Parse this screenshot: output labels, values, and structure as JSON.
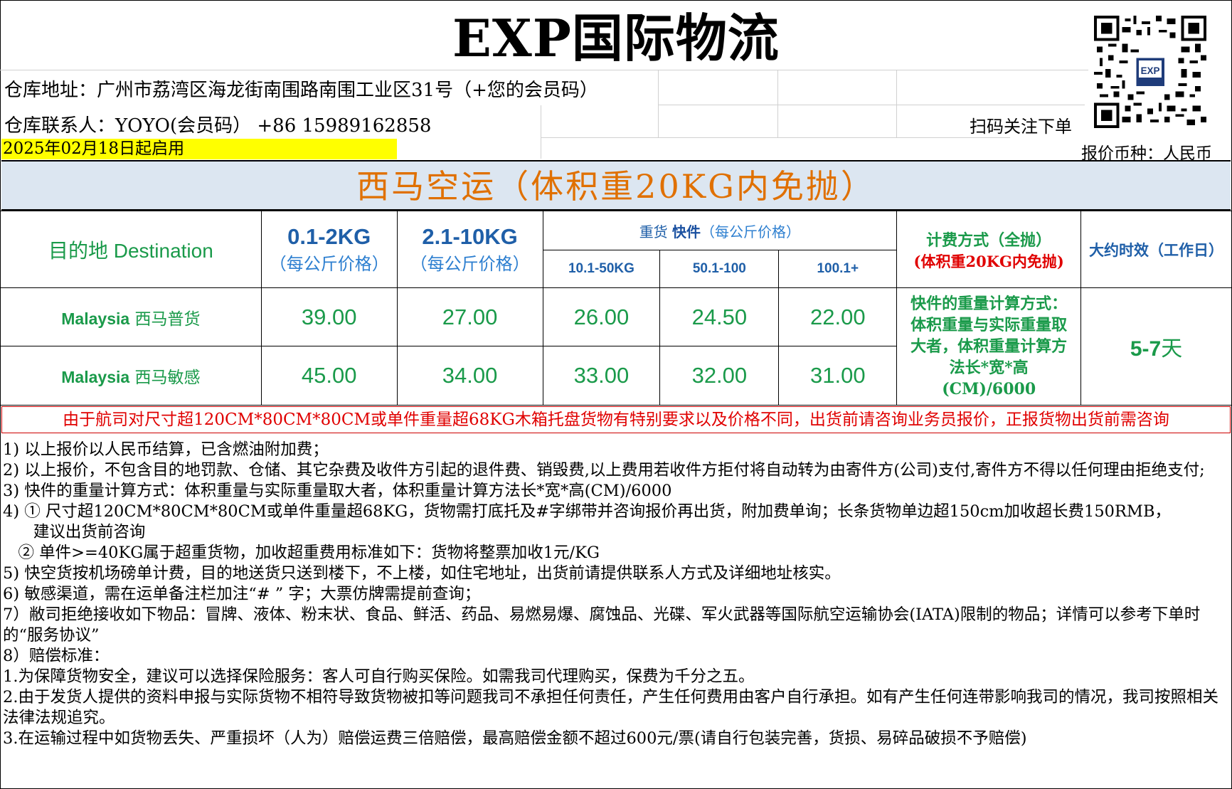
{
  "header": {
    "title": "EXP国际物流",
    "warehouse_address": "仓库地址：广州市荔湾区海龙街南围路南围工业区31号（+您的会员码）",
    "warehouse_contact": "仓库联系人：YOYO(会员码）  +86  15989162858",
    "effective_date": "2025年02月18日起启用",
    "scan_label": "扫码关注下单",
    "currency": "报价币种：人民币",
    "qr_logo": "EXP"
  },
  "banner": "西马空运（体积重20KG内免抛）",
  "table": {
    "col_destination": "目的地 Destination",
    "col1_main": "0.1-2KG",
    "col1_sub": "（每公斤价格）",
    "col2_main": "2.1-10KG",
    "col2_sub": "（每公斤价格）",
    "heavy_a": "重货",
    "heavy_b": "快件",
    "heavy_c": "（每公斤价格）",
    "tier1": "10.1-50KG",
    "tier2": "50.1-100",
    "tier3": "100.1+",
    "billing_title": "计费方式（全抛）",
    "billing_sub": "(体积重20KG内免抛)",
    "transit_title": "大约时效（工作日）",
    "rows": [
      {
        "dest_en": "Malaysia",
        "dest_cn": "西马普货",
        "p1": "39.00",
        "p2": "27.00",
        "p3": "26.00",
        "p4": "24.50",
        "p5": "22.00"
      },
      {
        "dest_en": "Malaysia",
        "dest_cn": "西马敏感",
        "p1": "45.00",
        "p2": "34.00",
        "p3": "33.00",
        "p4": "32.00",
        "p5": "31.00"
      }
    ],
    "billing_desc": "快件的重量计算方式：体积重量与实际重量取大者，体积重量计算方法长*宽*高(CM)/6000",
    "transit_num": "5-7",
    "transit_unit": "天"
  },
  "notice": "由于航司对尺寸超120CM*80CM*80CM或单件重量超68KG木箱托盘货物有特别要求以及价格不同，出货前请咨询业务员报价，正报货物出货前需咨询",
  "terms": [
    "1) 以上报价以人民币结算，已含燃油附加费；",
    "2) 以上报价，不包含目的地罚款、仓储、其它杂费及收件方引起的退件费、销毁费,以上费用若收件方拒付将自动转为由寄件方(公司)支付,寄件方不得以任何理由拒绝支付;",
    "3) 快件的重量计算方式：体积重量与实际重量取大者，体积重量计算方法长*宽*高(CM)/6000",
    "4) ① 尺寸超120CM*80CM*80CM或单件重量超68KG，货物需打底托及#字绑带并咨询报价再出货，附加费单询；长条货物单边超150cm加收超长费150RMB，",
    "      建议出货前咨询",
    "   ② 单件>=40KG属于超重货物，加收超重费用标准如下：货物将整票加收1元/KG",
    "5) 快空货按机场磅单计费，目的地送货只送到楼下，不上楼，如住宅地址，出货前请提供联系人方式及详细地址核实。",
    "6) 敏感渠道，需在运单备注栏加注“# ” 字；大票仿牌需提前查询；",
    "7）敝司拒绝接收如下物品：冒牌、液体、粉末状、食品、鲜活、药品、易燃易爆、腐蚀品、光碟、军火武器等国际航空运输协会(IATA)限制的物品；详情可以参考下单时的“服务协议”",
    "8）赔偿标准：",
    "1.为保障货物安全，建议可以选择保险服务：客人可自行购买保险。如需我司代理购买，保费为千分之五。",
    "2.由于发货人提供的资料申报与实际货物不相符导致货物被扣等问题我司不承担任何责任，产生任何费用由客户自行承担。如有产生任何连带影响我司的情况，我司按照相关法律法规追究。",
    "3.在运输过程中如货物丢失、严重损坏（人为）赔偿运费三倍赔偿，最高赔偿金额不超过600元/票(请自行包装完善，货损、易碎品破损不予赔偿)"
  ]
}
